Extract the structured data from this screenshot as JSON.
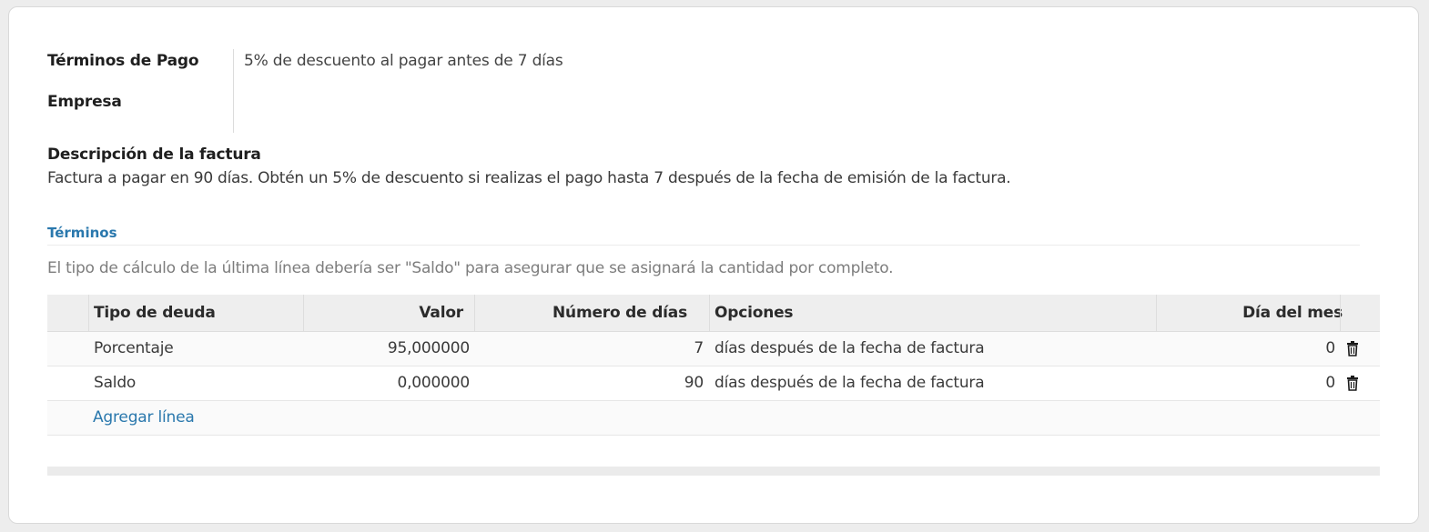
{
  "form": {
    "payment_terms_label": "Términos de Pago",
    "payment_terms_value": "5% de descuento al pagar antes de 7 días",
    "company_label": "Empresa",
    "company_value": ""
  },
  "invoice_description": {
    "title": "Descripción de la factura",
    "text": "Factura a pagar en 90 días. Obtén un 5% de descuento si realizas el pago hasta 7 después de la fecha de emisión de la factura."
  },
  "terms_section": {
    "title": "Términos",
    "hint": "El tipo de cálculo de la última línea debería ser \"Saldo\" para asegurar que se asignará la cantidad por completo."
  },
  "table": {
    "columns": {
      "debt_type": "Tipo de deuda",
      "value": "Valor",
      "days": "Número de días",
      "options": "Opciones",
      "day_of_month": "Día del mes"
    },
    "rows": [
      {
        "debt_type": "Porcentaje",
        "value": "95,000000",
        "days": "7",
        "options": "días después de la fecha de factura",
        "day_of_month": "0"
      },
      {
        "debt_type": "Saldo",
        "value": "0,000000",
        "days": "90",
        "options": "días después de la fecha de factura",
        "day_of_month": "0"
      }
    ],
    "add_line_label": "Agregar línea",
    "row_delete_icon": "trash-icon"
  },
  "colors": {
    "accent": "#2a78ad",
    "header_bg": "#eeeeee"
  }
}
